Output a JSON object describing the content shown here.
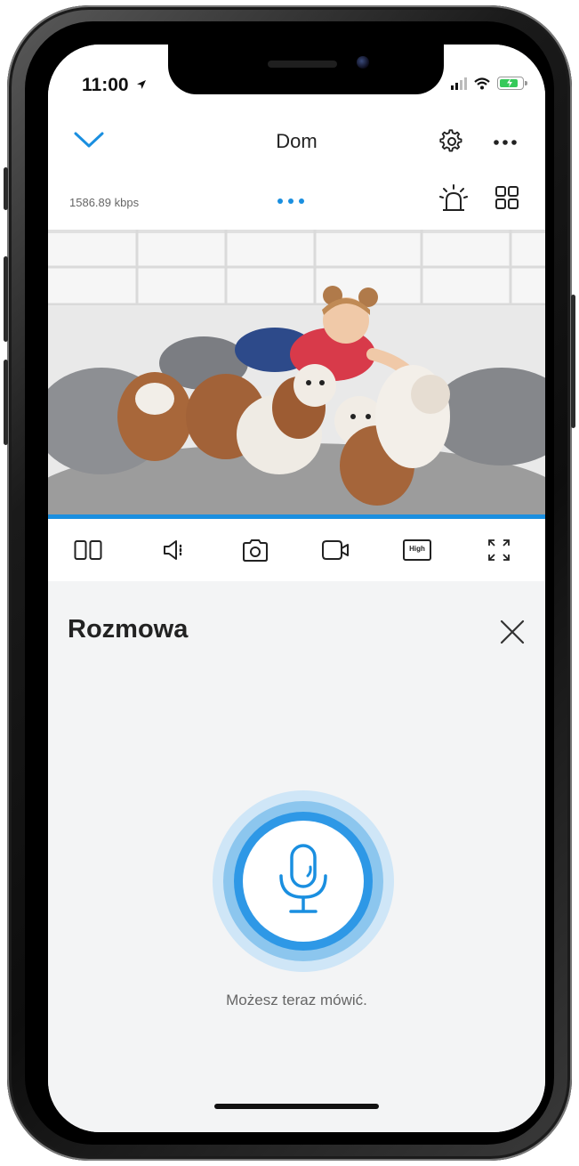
{
  "status_bar": {
    "time": "11:00",
    "icons": [
      "location-arrow-icon",
      "signal-icon",
      "wifi-icon",
      "battery-charging-icon"
    ]
  },
  "header": {
    "title": "Dom",
    "left_icon": "chevron-down-icon",
    "right_icons": [
      "gear-icon",
      "more-icon"
    ]
  },
  "info_row": {
    "bitrate": "1586.89 kbps",
    "page_dots": 3,
    "icons": [
      "alarm-siren-icon",
      "grid-view-icon"
    ]
  },
  "controls": {
    "items": [
      {
        "name": "split-view-icon"
      },
      {
        "name": "speaker-icon"
      },
      {
        "name": "snapshot-camera-icon"
      },
      {
        "name": "record-video-icon"
      },
      {
        "name": "quality-button",
        "label": "High"
      },
      {
        "name": "fullscreen-icon"
      }
    ]
  },
  "talk_panel": {
    "title": "Rozmowa",
    "close_icon": "close-icon",
    "mic_icon": "microphone-icon",
    "hint": "Możesz teraz mówić."
  },
  "colors": {
    "accent": "#1a8fe0",
    "background": "#f3f4f5",
    "battery": "#36c95a"
  }
}
